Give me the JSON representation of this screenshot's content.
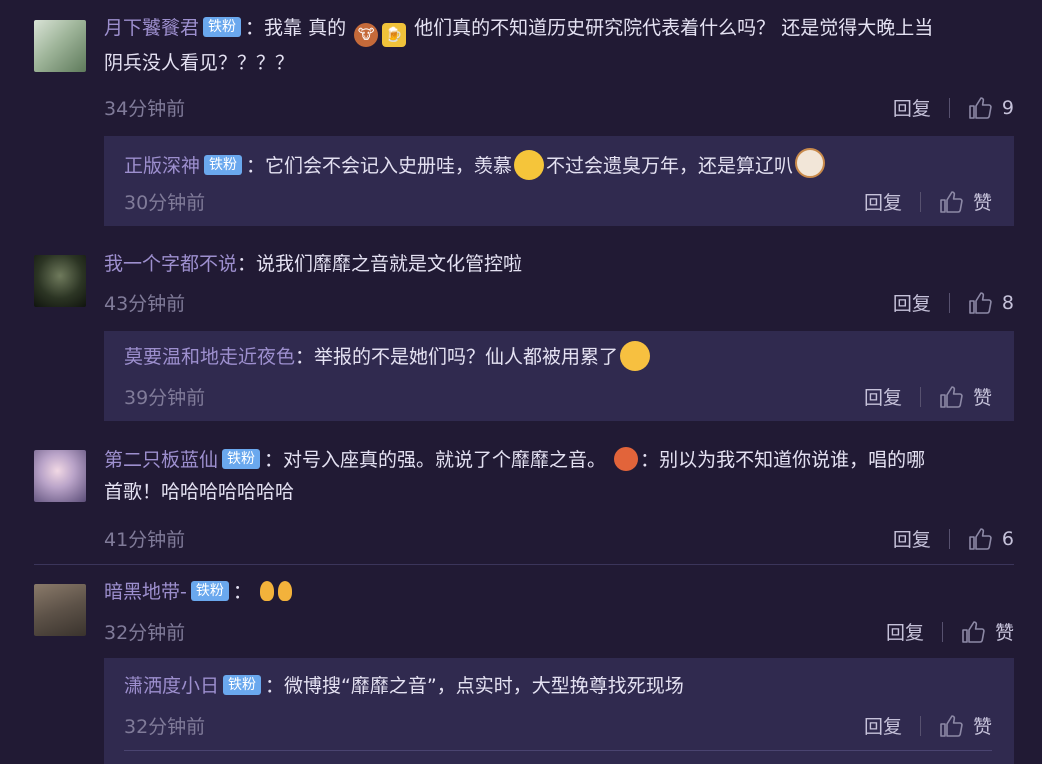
{
  "comments": [
    {
      "user": "月下饕餮君",
      "badge": "铁粉",
      "text1": "我靠 真的",
      "text2": "他们真的不知道历史研究院代表着什么吗？ 还是觉得大晚上当",
      "text3": "阴兵没人看见？？？？",
      "time": "34分钟前",
      "reply_label": "回复",
      "likes": "9",
      "reply": {
        "user": "正版深神",
        "badge": "铁粉",
        "text1": "它们会不会记入史册哇，羡慕",
        "text2": "不过会遗臭万年，还是算辽叭",
        "time": "30分钟前",
        "reply_label": "回复",
        "like_label": "赞"
      }
    },
    {
      "user": "我一个字都不说",
      "text": "说我们靡靡之音就是文化管控啦",
      "time": "43分钟前",
      "reply_label": "回复",
      "likes": "8",
      "reply": {
        "user": "莫要温和地走近夜色",
        "text": "举报的不是她们吗？仙人都被用累了",
        "time": "39分钟前",
        "reply_label": "回复",
        "like_label": "赞"
      }
    },
    {
      "user": "第二只板蓝仙",
      "badge": "铁粉",
      "text1": "对号入座真的强。就说了个靡靡之音。",
      "text2": "：别以为我不知道你说谁，唱的哪",
      "text3": "首歌！哈哈哈哈哈哈哈",
      "time": "41分钟前",
      "reply_label": "回复",
      "likes": "6"
    },
    {
      "user": "暗黑地带-",
      "badge": "铁粉",
      "time": "32分钟前",
      "reply_label": "回复",
      "like_label": "赞",
      "reply": {
        "user": "潇洒度小日",
        "badge": "铁粉",
        "text": "微博搜“靡靡之音”，点实时，大型挽尊找死现场",
        "time": "32分钟前",
        "reply_label": "回复",
        "like_label": "赞"
      }
    }
  ],
  "colors": {
    "background": "#211a34",
    "reply_box": "#302a4f",
    "username": "#9d8fce",
    "badge": "#6aa8ee"
  }
}
